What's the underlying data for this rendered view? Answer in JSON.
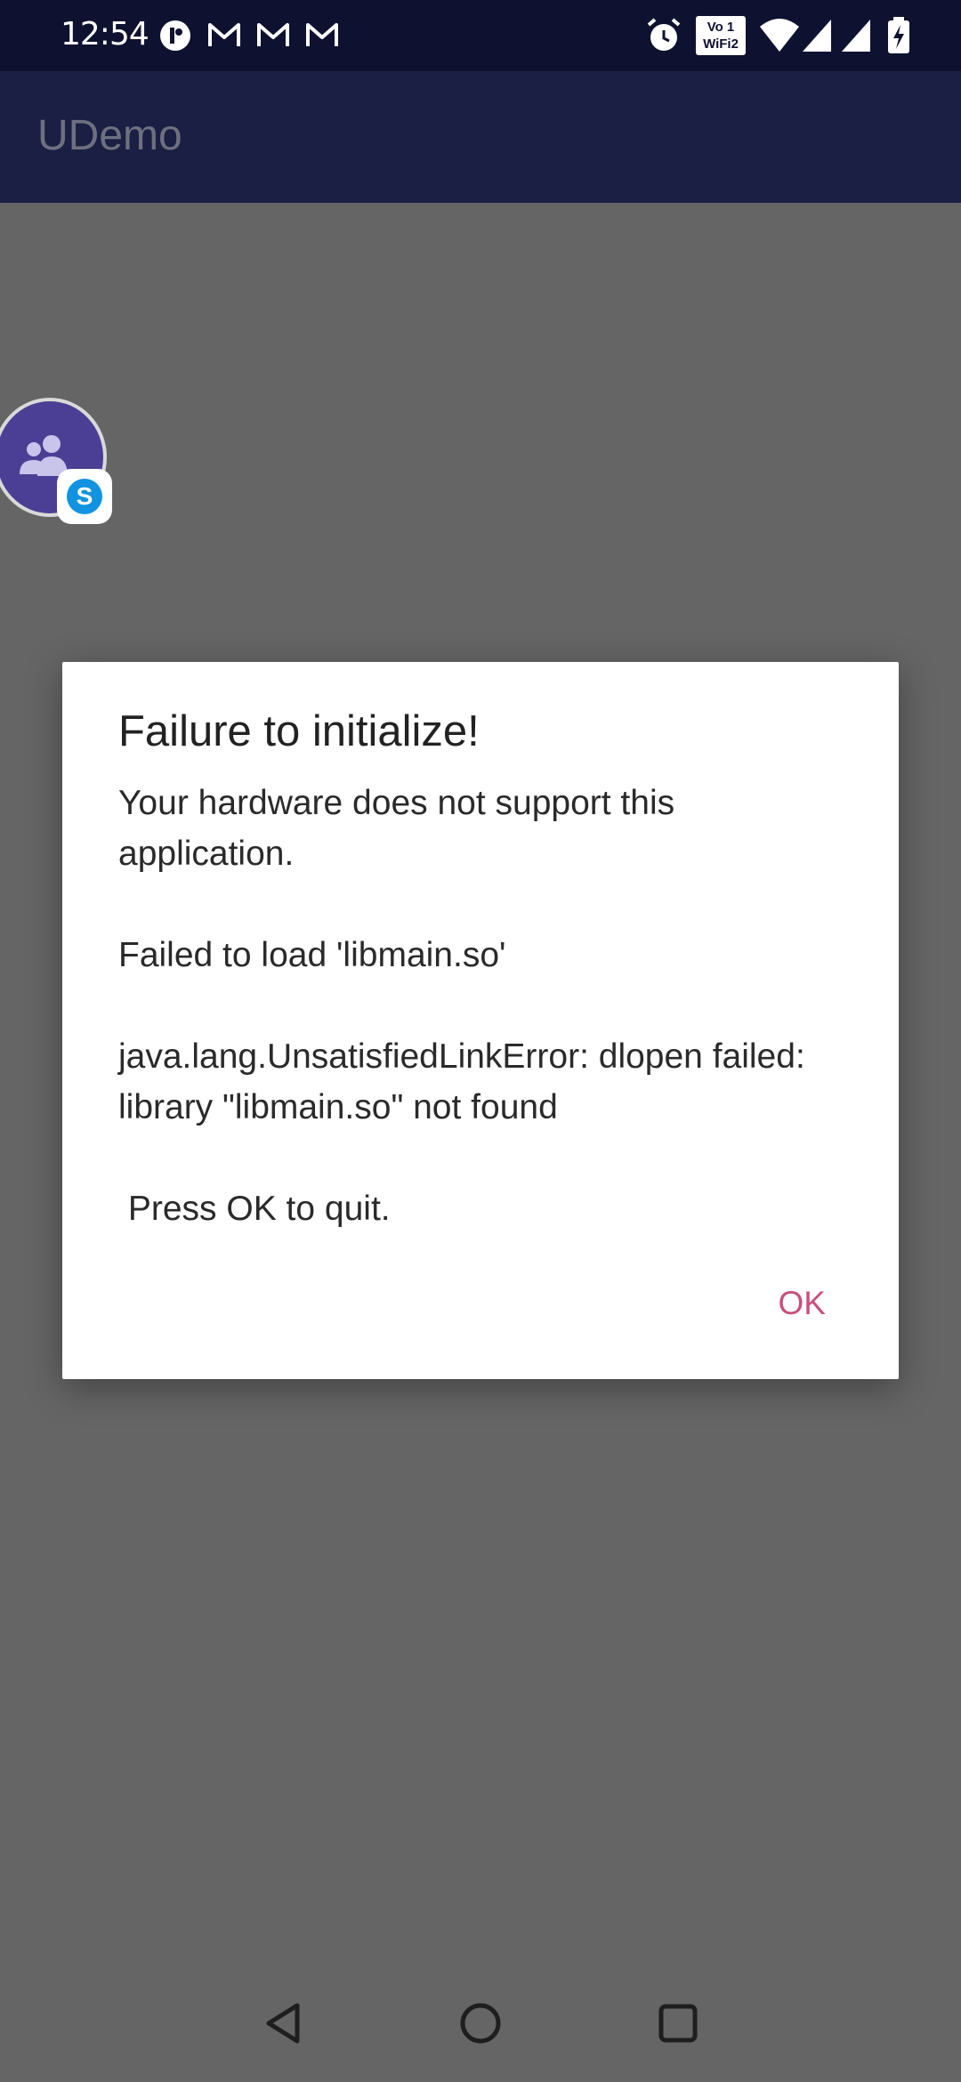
{
  "status_bar": {
    "time": "12:54",
    "left_icons": [
      "notification-dot-icon",
      "gmail-icon",
      "gmail-icon",
      "gmail-icon"
    ],
    "right_icons": [
      "alarm-icon",
      "vowifi-icon",
      "wifi-icon",
      "signal-icon",
      "signal-icon",
      "battery-charging-icon"
    ],
    "vowifi_label": "WiFi2"
  },
  "app_bar": {
    "title": "UDemo"
  },
  "bubble": {
    "badge_letter": "S"
  },
  "dialog": {
    "title": "Failure to initialize!",
    "message_paragraphs": [
      "Your hardware does not support this application.",
      "Failed to load 'libmain.so'",
      "java.lang.UnsatisfiedLinkError: dlopen failed: library \"libmain.so\" not found",
      " Press OK to quit."
    ],
    "ok_label": "OK"
  },
  "nav_bar": {
    "buttons": [
      "back-icon",
      "home-icon",
      "recents-icon"
    ]
  },
  "colors": {
    "status_bar_bg": "#0e1230",
    "app_bar_bg": "#1b1f43",
    "scrim": "#656565",
    "accent": "#c8507d",
    "bubble": "#4a3f94"
  }
}
